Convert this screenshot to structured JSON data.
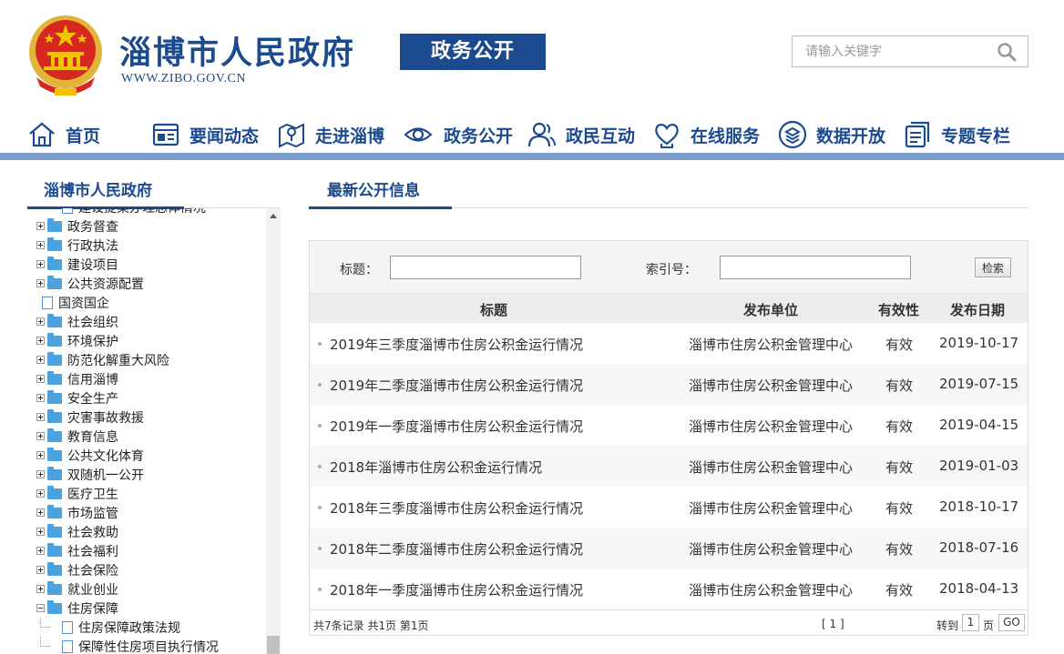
{
  "header": {
    "site_name": "淄博市人民政府",
    "site_url": "WWW.ZIBO.GOV.CN",
    "badge": "政务公开",
    "search_placeholder": "请输入关键字"
  },
  "nav": [
    {
      "label": "首页",
      "icon": "home-icon"
    },
    {
      "label": "要闻动态",
      "icon": "news-icon"
    },
    {
      "label": "走进淄博",
      "icon": "map-pin-icon"
    },
    {
      "label": "政务公开",
      "icon": "eye-icon"
    },
    {
      "label": "政民互动",
      "icon": "people-icon"
    },
    {
      "label": "在线服务",
      "icon": "heart-hand-icon"
    },
    {
      "label": "数据开放",
      "icon": "layers-icon"
    },
    {
      "label": "专题专栏",
      "icon": "document-icon"
    }
  ],
  "sidebar": {
    "title": "淄博市人民政府",
    "items": [
      {
        "label": "建设提案办理总体情况",
        "type": "leaf"
      },
      {
        "label": "政务督查",
        "type": "folder",
        "expanded": false
      },
      {
        "label": "行政执法",
        "type": "folder",
        "expanded": false
      },
      {
        "label": "建设项目",
        "type": "folder",
        "expanded": false
      },
      {
        "label": "公共资源配置",
        "type": "folder",
        "expanded": false
      },
      {
        "label": "国资国企",
        "type": "doc"
      },
      {
        "label": "社会组织",
        "type": "folder",
        "expanded": false
      },
      {
        "label": "环境保护",
        "type": "folder",
        "expanded": false
      },
      {
        "label": "防范化解重大风险",
        "type": "folder",
        "expanded": false
      },
      {
        "label": "信用淄博",
        "type": "folder",
        "expanded": false
      },
      {
        "label": "安全生产",
        "type": "folder",
        "expanded": false
      },
      {
        "label": "灾害事故救援",
        "type": "folder",
        "expanded": false
      },
      {
        "label": "教育信息",
        "type": "folder",
        "expanded": false
      },
      {
        "label": "公共文化体育",
        "type": "folder",
        "expanded": false
      },
      {
        "label": "双随机一公开",
        "type": "folder",
        "expanded": false
      },
      {
        "label": "医疗卫生",
        "type": "folder",
        "expanded": false
      },
      {
        "label": "市场监管",
        "type": "folder",
        "expanded": false
      },
      {
        "label": "社会救助",
        "type": "folder",
        "expanded": false
      },
      {
        "label": "社会福利",
        "type": "folder",
        "expanded": false
      },
      {
        "label": "社会保险",
        "type": "folder",
        "expanded": false
      },
      {
        "label": "就业创业",
        "type": "folder",
        "expanded": false
      },
      {
        "label": "住房保障",
        "type": "folder",
        "expanded": true
      },
      {
        "label": "住房保障政策法规",
        "type": "leaf"
      },
      {
        "label": "保障性住房项目执行情况",
        "type": "leaf"
      }
    ]
  },
  "main": {
    "title": "最新公开信息",
    "filter": {
      "title_label": "标题：",
      "index_label": "索引号：",
      "search_button": "检索"
    },
    "columns": [
      "标题",
      "发布单位",
      "有效性",
      "发布日期"
    ],
    "rows": [
      {
        "title": "2019年三季度淄博市住房公积金运行情况",
        "unit": "淄博市住房公积金管理中心",
        "validity": "有效",
        "date": "2019-10-17"
      },
      {
        "title": "2019年二季度淄博市住房公积金运行情况",
        "unit": "淄博市住房公积金管理中心",
        "validity": "有效",
        "date": "2019-07-15"
      },
      {
        "title": "2019年一季度淄博市住房公积金运行情况",
        "unit": "淄博市住房公积金管理中心",
        "validity": "有效",
        "date": "2019-04-15"
      },
      {
        "title": "2018年淄博市住房公积金运行情况",
        "unit": "淄博市住房公积金管理中心",
        "validity": "有效",
        "date": "2019-01-03"
      },
      {
        "title": "2018年三季度淄博市住房公积金运行情况",
        "unit": "淄博市住房公积金管理中心",
        "validity": "有效",
        "date": "2018-10-17"
      },
      {
        "title": "2018年二季度淄博市住房公积金运行情况",
        "unit": "淄博市住房公积金管理中心",
        "validity": "有效",
        "date": "2018-07-16"
      },
      {
        "title": "2018年一季度淄博市住房公积金运行情况",
        "unit": "淄博市住房公积金管理中心",
        "validity": "有效",
        "date": "2018-04-13"
      }
    ],
    "pager": {
      "info": "共7条记录  共1页  第1页",
      "pages": "[ 1 ]",
      "goto_label": "转到",
      "page_value": "1",
      "page_unit": "页",
      "go_button": "GO"
    }
  },
  "colors": {
    "brand_blue": "#1b4a8f",
    "nav_bar": "#7a9cc8",
    "emblem_red": "#d7281f",
    "emblem_gold": "#f3c300"
  }
}
